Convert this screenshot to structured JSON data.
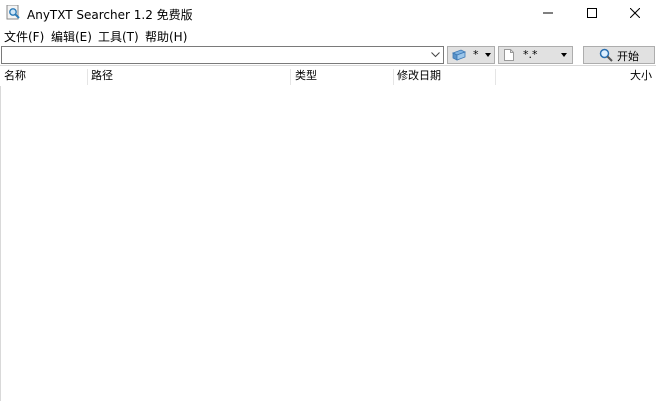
{
  "window": {
    "title": "AnyTXT Searcher 1.2 免费版",
    "icon": "app-magnifier-icon"
  },
  "menu": {
    "items": [
      {
        "label": "文件(F)"
      },
      {
        "label": "编辑(E)"
      },
      {
        "label": "工具(T)"
      },
      {
        "label": "帮助(H)"
      }
    ]
  },
  "toolbar": {
    "search_value": "",
    "drive_filter": "*",
    "type_filter": "*.*",
    "start_label": "开始"
  },
  "results": {
    "columns": [
      {
        "label": "名称"
      },
      {
        "label": "路径"
      },
      {
        "label": "类型"
      },
      {
        "label": "修改日期"
      },
      {
        "label": "大小"
      }
    ],
    "rows": []
  }
}
